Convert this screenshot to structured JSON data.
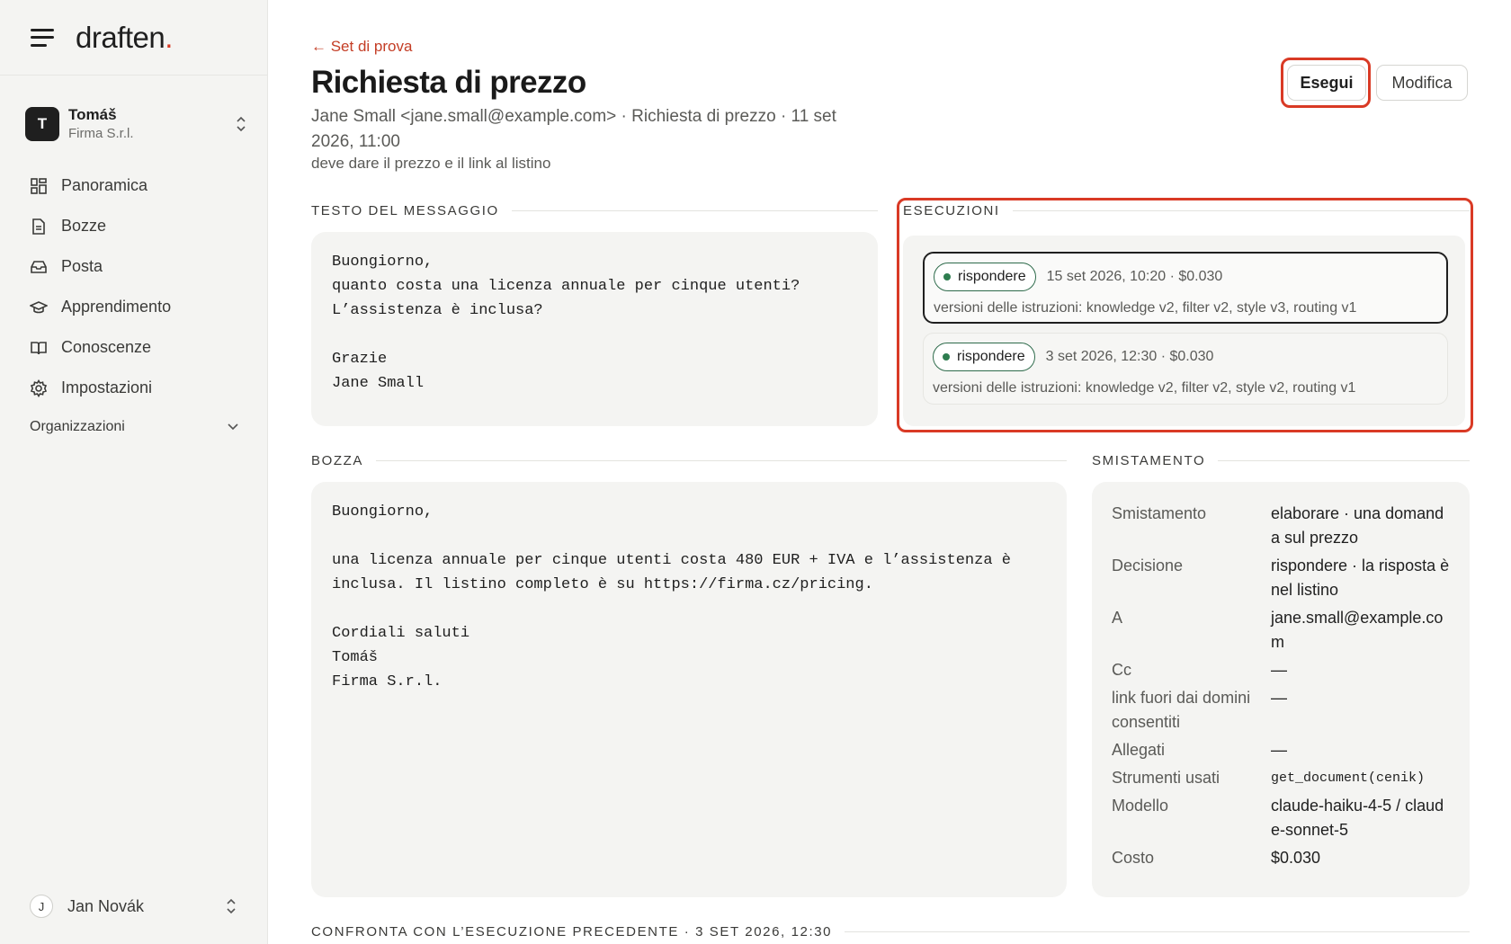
{
  "brand": {
    "logo": "draften",
    "logo_dot": "."
  },
  "org": {
    "initial": "T",
    "name": "Tomáš",
    "company": "Firma S.r.l."
  },
  "nav": [
    {
      "label": "Panoramica",
      "icon": "grid-icon"
    },
    {
      "label": "Bozze",
      "icon": "document-icon"
    },
    {
      "label": "Posta",
      "icon": "inbox-icon"
    },
    {
      "label": "Apprendimento",
      "icon": "graduation-cap-icon"
    },
    {
      "label": "Conoscenze",
      "icon": "book-icon"
    },
    {
      "label": "Impostazioni",
      "icon": "gear-icon"
    }
  ],
  "organizations_label": "Organizzazioni",
  "user": {
    "initial": "J",
    "name": "Jan Novák"
  },
  "header": {
    "back": "← Set di prova",
    "title": "Richiesta di prezzo",
    "meta": "Jane Small <jane.small@example.com> · Richiesta di prezzo · 11 set 2026, 11:00",
    "note": "deve dare il prezzo e il link al listino",
    "run_button": "Esegui",
    "edit_button": "Modifica"
  },
  "message": {
    "label": "TESTO DEL MESSAGGIO",
    "body": "Buongiorno,\nquanto costa una licenza annuale per cinque utenti?\nL’assistenza è inclusa?\n\nGrazie\nJane Small"
  },
  "runs": {
    "label": "ESECUZIONI",
    "items": [
      {
        "status": "rispondere",
        "meta": "15 set 2026, 10:20 · $0.030",
        "desc": "versioni delle istruzioni: knowledge v2, filter v2, style v3, routing v1"
      },
      {
        "status": "rispondere",
        "meta": "3 set 2026, 12:30 · $0.030",
        "desc": "versioni delle istruzioni: knowledge v2, filter v2, style v2, routing v1"
      }
    ]
  },
  "draft": {
    "label": "BOZZA",
    "body": "Buongiorno,\n\nuna licenza annuale per cinque utenti costa 480 EUR + IVA e l’assistenza è\ninclusa. Il listino completo è su https://firma.cz/pricing.\n\nCordiali saluti\nTomáš\nFirma S.r.l."
  },
  "routing": {
    "label": "SMISTAMENTO",
    "rows": [
      {
        "key": "Smistamento",
        "value": "elaborare · una domanda sul prezzo"
      },
      {
        "key": "Decisione",
        "value": "rispondere · la risposta è nel listino"
      },
      {
        "key": "A",
        "value": "jane.small@example.com"
      },
      {
        "key": "Cc",
        "value": "—"
      },
      {
        "key": "link fuori dai domini consentiti",
        "value": "—"
      },
      {
        "key": "Allegati",
        "value": "—"
      },
      {
        "key": "Strumenti usati",
        "value": "get_document(cenik)"
      },
      {
        "key": "Modello",
        "value": "claude-haiku-4-5 / claude-sonnet-5"
      },
      {
        "key": "Costo",
        "value": "$0.030"
      }
    ]
  },
  "compare": {
    "label": "CONFRONTA CON L’ESECUZIONE PRECEDENTE · 3 SET 2026, 12:30"
  },
  "colors": {
    "accent": "#d93a25",
    "status_green": "#2e7d4f"
  }
}
